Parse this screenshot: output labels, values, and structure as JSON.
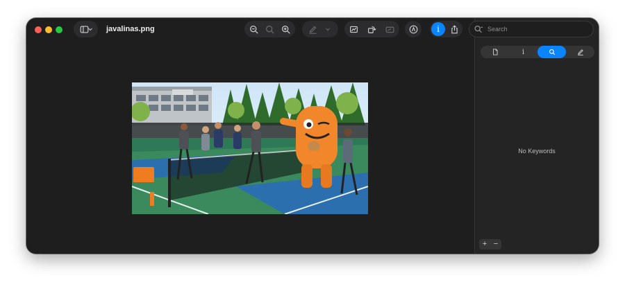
{
  "window": {
    "title": "javalinas.png",
    "traffic_lights": [
      "close",
      "minimize",
      "zoom"
    ]
  },
  "toolbar": {
    "sidebar_toggle_icon": "sidebar-icon",
    "zoom_out_icon": "zoom-out-icon",
    "actual_size_icon": "actual-size-icon",
    "zoom_in_icon": "zoom-in-icon",
    "highlight_icon": "pen-icon",
    "highlight_menu_icon": "chevron-down-icon",
    "crop_icon": "crop-icon",
    "rotate_icon": "rotate-icon",
    "markup_icon": "markup-icon",
    "annotate_icon": "annotate-icon",
    "info_icon": "info-icon",
    "share_icon": "share-icon"
  },
  "search": {
    "placeholder": "Search"
  },
  "inspector": {
    "tabs": [
      {
        "name": "general",
        "icon": "document-icon"
      },
      {
        "name": "info",
        "icon": "info-icon"
      },
      {
        "name": "keywords",
        "icon": "search-icon",
        "active": true
      },
      {
        "name": "annotations",
        "icon": "pencil-icon"
      }
    ],
    "empty_message": "No Keywords",
    "add_label": "+",
    "remove_label": "−"
  },
  "image": {
    "subject": "people playing pickleball with an orange mascot"
  },
  "colors": {
    "accent": "#0a84ff",
    "window_bg": "#1e1e1e",
    "inspector_bg": "#242424"
  }
}
